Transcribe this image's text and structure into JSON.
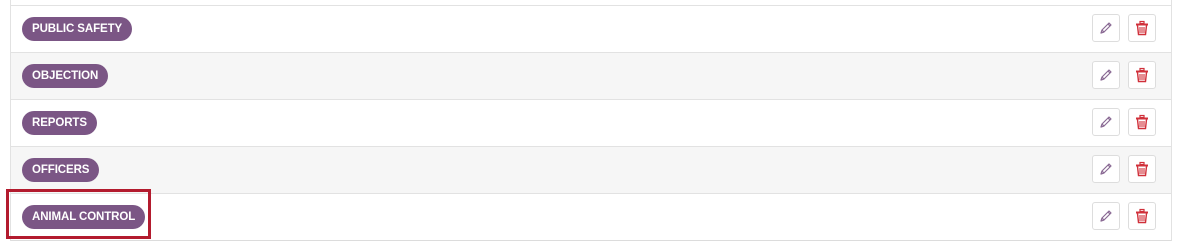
{
  "categories": [
    {
      "label": "PUBLIC SAFETY"
    },
    {
      "label": "OBJECTION"
    },
    {
      "label": "REPORTS"
    },
    {
      "label": "OFFICERS"
    },
    {
      "label": "ANIMAL CONTROL"
    }
  ],
  "icons": {
    "edit": "pencil-icon",
    "delete": "trash-icon"
  },
  "colors": {
    "tag_background": "#7b5685",
    "tag_text": "#ffffff",
    "edit_icon": "#8a6a94",
    "delete_icon": "#d0303a",
    "highlight_border": "#b31b2e",
    "striped_row": "#f6f6f6"
  }
}
